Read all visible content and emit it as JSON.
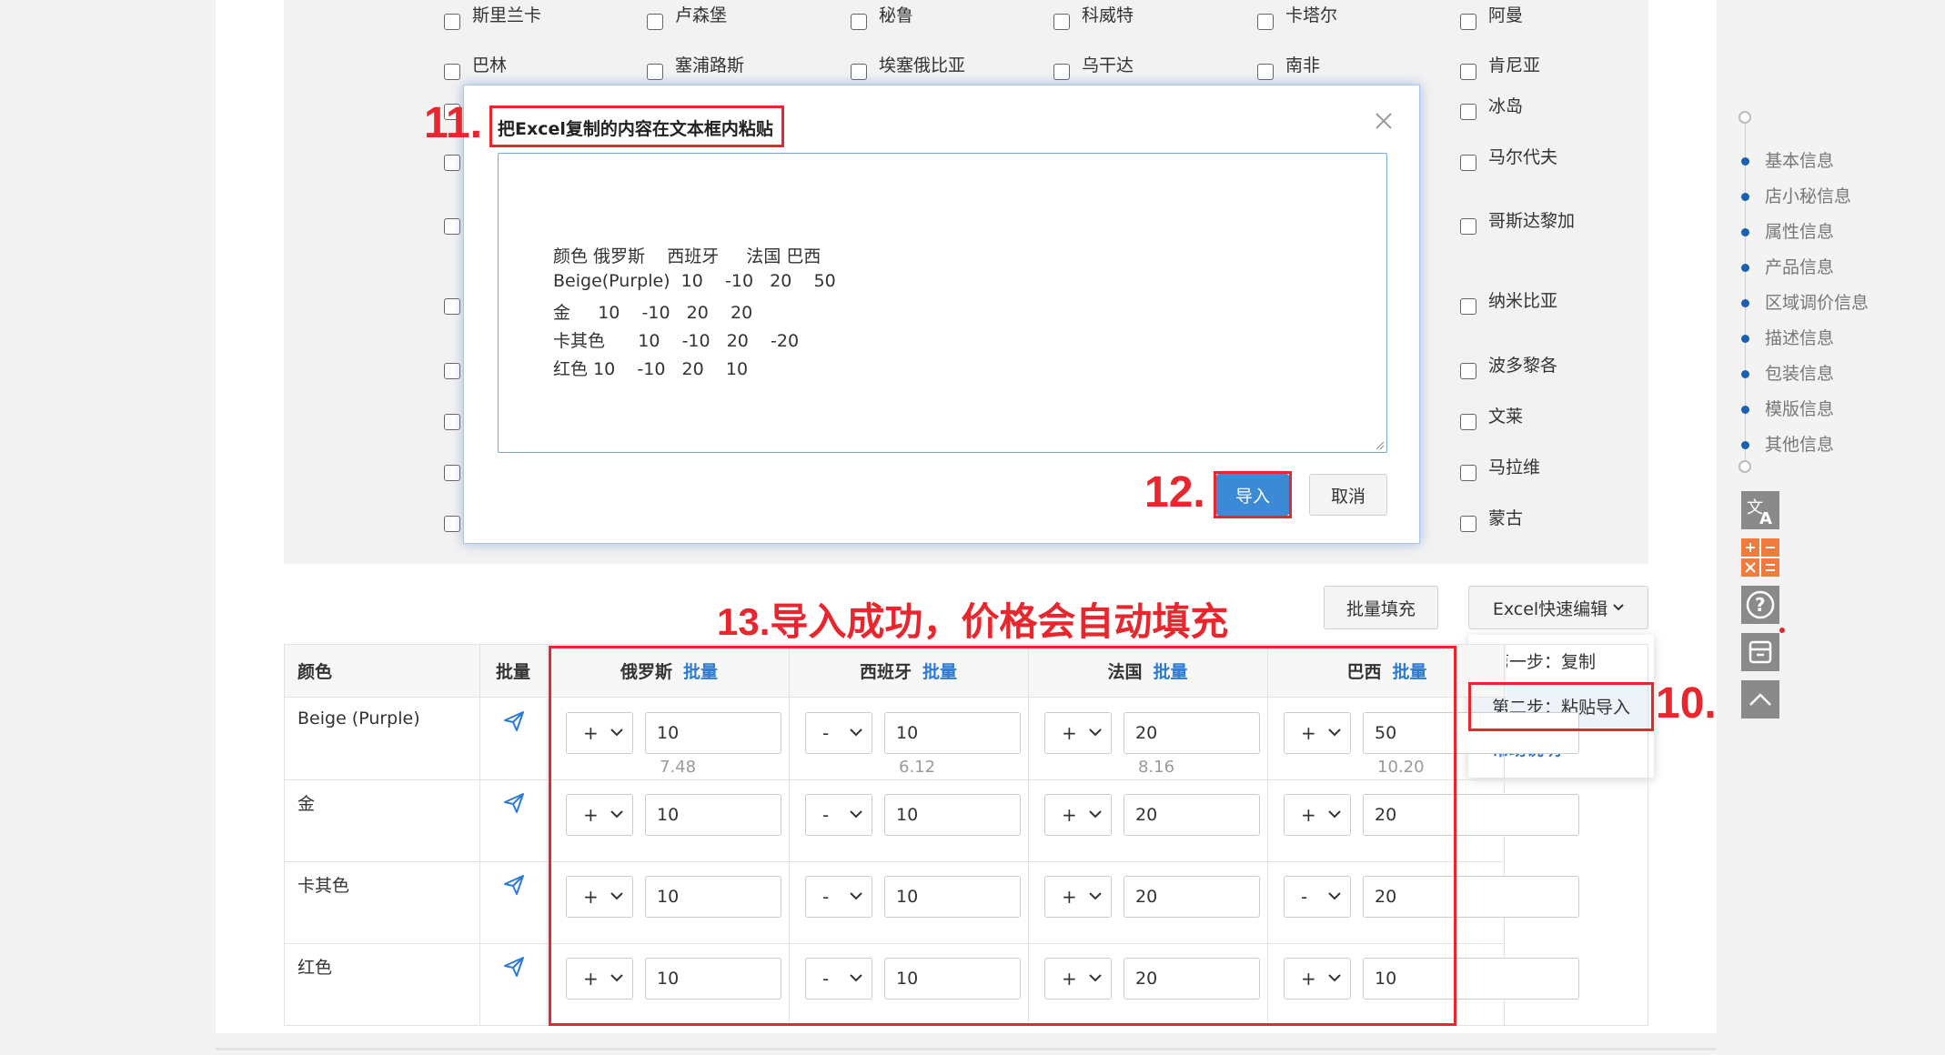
{
  "countries": [
    [
      "斯里兰卡",
      "卢森堡",
      "秘鲁",
      "科威特",
      "卡塔尔",
      "阿曼"
    ],
    [
      "巴林",
      "塞浦路斯",
      "埃塞俄比亚",
      "乌干达",
      "南非",
      "肯尼亚"
    ]
  ],
  "countries_right": [
    "冰岛",
    "马尔代夫",
    "哥斯达黎加",
    "纳米比亚",
    "波多黎各",
    "文莱",
    "马拉维",
    "蒙古"
  ],
  "toolbar": {
    "batch_fill": "批量填充",
    "excel_edit": "Excel快速编辑"
  },
  "excel_menu": {
    "step1": "第一步：复制",
    "step2": "第二步：粘贴导入",
    "help": "帮助说明"
  },
  "modal": {
    "title": "把Excel复制的内容在文本框内粘贴",
    "paste_lines": [
      "颜色 俄罗斯    西班牙     法国 巴西",
      "Beige(Purple)  10    -10   20    50",
      "金     10    -10   20    20",
      "卡其色      10    -10   20    -20",
      "红色 10    -10   20    10"
    ],
    "import": "导入",
    "cancel": "取消"
  },
  "table": {
    "header_color": "颜色",
    "header_bulk": "批量",
    "bulk_link": "批量",
    "countries": [
      "俄罗斯",
      "西班牙",
      "法国",
      "巴西"
    ],
    "rows": [
      {
        "color": "Beige (Purple)",
        "cells": [
          {
            "sign": "+",
            "value": "10",
            "converted": "7.48"
          },
          {
            "sign": "-",
            "value": "10",
            "converted": "6.12"
          },
          {
            "sign": "+",
            "value": "20",
            "converted": "8.16"
          },
          {
            "sign": "+",
            "value": "50",
            "converted": "10.20"
          }
        ]
      },
      {
        "color": "金",
        "cells": [
          {
            "sign": "+",
            "value": "10"
          },
          {
            "sign": "-",
            "value": "10"
          },
          {
            "sign": "+",
            "value": "20"
          },
          {
            "sign": "+",
            "value": "20"
          }
        ]
      },
      {
        "color": "卡其色",
        "cells": [
          {
            "sign": "+",
            "value": "10"
          },
          {
            "sign": "-",
            "value": "10"
          },
          {
            "sign": "+",
            "value": "20"
          },
          {
            "sign": "-",
            "value": "20"
          }
        ]
      },
      {
        "color": "红色",
        "cells": [
          {
            "sign": "+",
            "value": "10"
          },
          {
            "sign": "-",
            "value": "10"
          },
          {
            "sign": "+",
            "value": "20"
          },
          {
            "sign": "+",
            "value": "10"
          }
        ]
      }
    ]
  },
  "annotations": {
    "step10": "10.",
    "step11": "11.",
    "step12": "12.",
    "step13": "13.导入成功，价格会自动填充"
  },
  "side_nav": [
    "基本信息",
    "店小秘信息",
    "属性信息",
    "产品信息",
    "区域调价信息",
    "描述信息",
    "包装信息",
    "模版信息",
    "其他信息"
  ],
  "colors": {
    "accent": "#3c8ad6",
    "link": "#2d7bd3",
    "annotation": "#e8262d",
    "nav_dot": "#1a5fb0"
  }
}
